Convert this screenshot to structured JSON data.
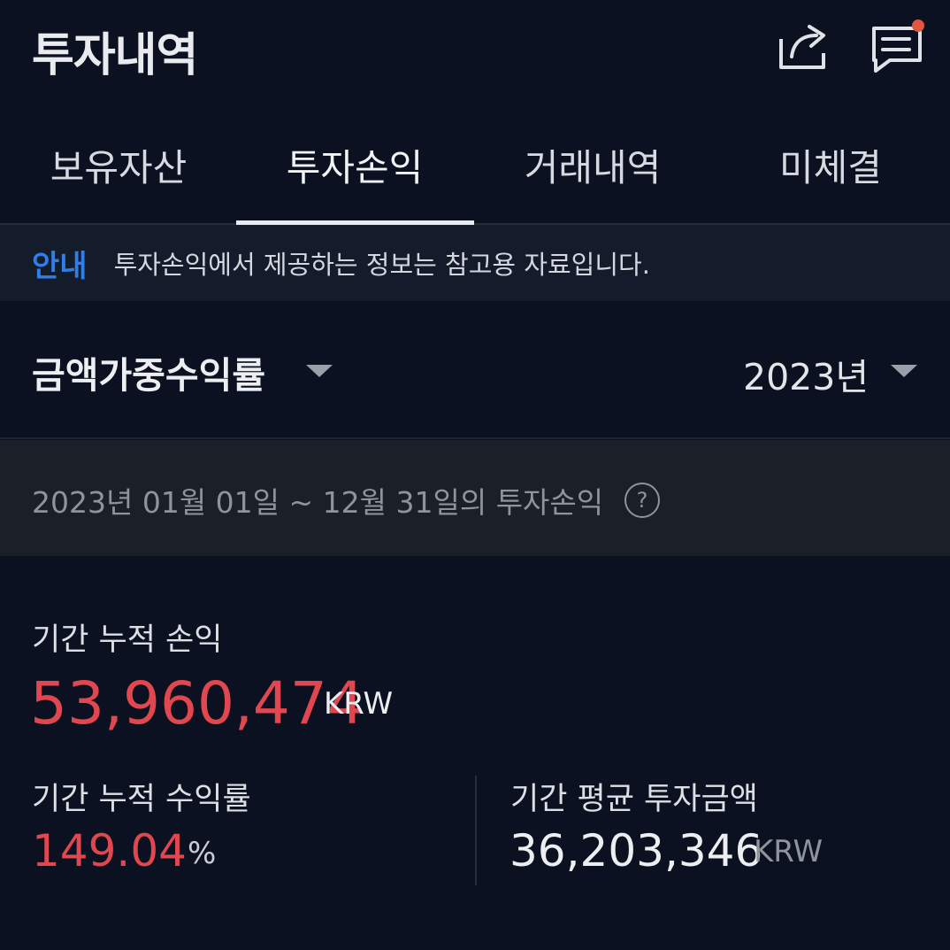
{
  "header": {
    "title": "투자내역",
    "share_icon": "share-icon",
    "chat_icon": "chat-icon",
    "notification_color": "#e2553e"
  },
  "tabs": [
    {
      "label": "보유자산",
      "active": false
    },
    {
      "label": "투자손익",
      "active": true
    },
    {
      "label": "거래내역",
      "active": false
    },
    {
      "label": "미체결",
      "active": false
    }
  ],
  "notice": {
    "tag": "안내",
    "text": "투자손익에서 제공하는 정보는 참고용 자료입니다."
  },
  "filter": {
    "metric": "금액가중수익률",
    "year": "2023년"
  },
  "period": {
    "text": "2023년 01월 01일 ~ 12월 31일의 투자손익",
    "help": "?"
  },
  "summary": {
    "cumulative_pl_label": "기간 누적 손익",
    "cumulative_pl_value": "53,960,474",
    "cumulative_pl_unit": "KRW",
    "cumulative_return_label": "기간 누적 수익률",
    "cumulative_return_value": "149.04",
    "cumulative_return_unit": "%",
    "avg_investment_label": "기간 평균 투자금액",
    "avg_investment_value": "36,203,346",
    "avg_investment_unit": "KRW"
  },
  "colors": {
    "background": "#0b1120",
    "profit_red": "#e0474f",
    "accent_blue": "#2f7fe6"
  }
}
